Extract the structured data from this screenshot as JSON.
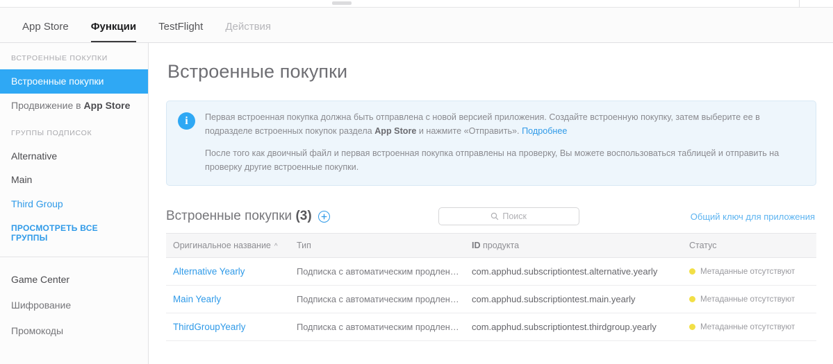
{
  "topbar": {
    "tabs": [
      {
        "label": "App Store",
        "state": "normal"
      },
      {
        "label": "Функции",
        "state": "active"
      },
      {
        "label": "TestFlight",
        "state": "normal"
      },
      {
        "label": "Действия",
        "state": "dim"
      }
    ]
  },
  "sidebar": {
    "group1_heading": "ВСТРОЕННЫЕ ПОКУПКИ",
    "items1": [
      {
        "label": "Встроенные покупки",
        "state": "selected"
      },
      {
        "label_prefix": "Продвижение в ",
        "label_bold": "App Store",
        "state": "normal"
      }
    ],
    "group2_heading": "ГРУППЫ ПОДПИСОК",
    "items2": [
      {
        "label": "Alternative",
        "state": "strong"
      },
      {
        "label": "Main",
        "state": "strong"
      },
      {
        "label": "Third Group",
        "state": "link"
      }
    ],
    "view_all_label": "ПРОСМОТРЕТЬ ВСЕ ГРУППЫ",
    "items3": [
      {
        "label": "Game Center",
        "state": "strong"
      },
      {
        "label": "Шифрование",
        "state": "normal"
      },
      {
        "label": "Промокоды",
        "state": "normal"
      }
    ]
  },
  "main": {
    "page_title": "Встроенные покупки",
    "banner": {
      "icon": "info-icon",
      "p1_part1": "Первая встроенная покупка должна быть отправлена с новой версией приложения. Создайте встроенную покупку, затем выберите ее в подразделе встроенных покупок раздела ",
      "p1_bold": "App Store",
      "p1_part2": " и нажмите «Отправить». ",
      "p1_link": "Подробнее",
      "p2": "После того как двоичный файл и первая встроенная покупка отправлены на проверку, Вы можете воспользоваться таблицей и отправить на проверку другие встроенные покупки."
    },
    "section": {
      "title_text": "Встроенные покупки ",
      "title_count": "(3)",
      "add_button_label": "+",
      "search_placeholder": "Поиск",
      "search_value": "",
      "shared_secret_link": "Общий ключ для приложения"
    },
    "table": {
      "columns": [
        {
          "label": "Оригинальное название",
          "sort": "▲"
        },
        {
          "label": "Тип"
        },
        {
          "label_bold": "ID",
          "label_rest": " продукта"
        },
        {
          "label": "Статус"
        }
      ],
      "rows": [
        {
          "name": "Alternative Yearly",
          "type": "Подписка с автоматическим продлением",
          "product_id": "com.apphud.subscriptiontest.alternative.yearly",
          "status": "Метаданные отсутствуют",
          "status_color": "#f2df46"
        },
        {
          "name": "Main Yearly",
          "type": "Подписка с автоматическим продлением",
          "product_id": "com.apphud.subscriptiontest.main.yearly",
          "status": "Метаданные отсутствуют",
          "status_color": "#f2df46"
        },
        {
          "name": "ThirdGroupYearly",
          "type": "Подписка с автоматическим продлением",
          "product_id": "com.apphud.subscriptiontest.thirdgroup.yearly",
          "status": "Метаданные отсутствуют",
          "status_color": "#f2df46"
        }
      ]
    }
  },
  "colors": {
    "accent_blue": "#2fa8f4",
    "link_blue": "#2f9ae8",
    "status_yellow": "#f2df46",
    "banner_bg": "#eef6fc"
  }
}
